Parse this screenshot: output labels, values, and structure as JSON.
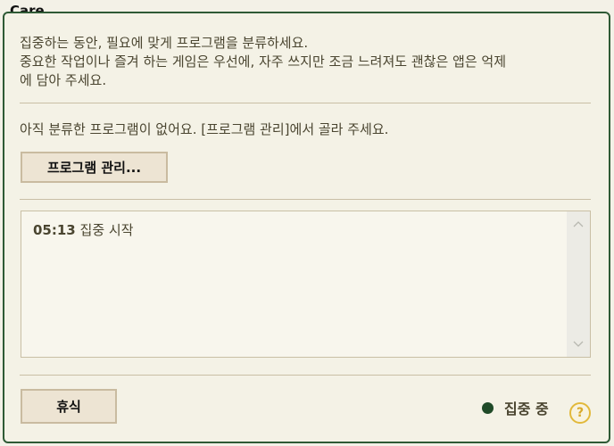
{
  "panel": {
    "title": "Care"
  },
  "intro": {
    "lines": [
      "집중하는 동안, 필요에 맞게 프로그램을 분류하세요.",
      "중요한 작업이나 즐겨 하는 게임은 우선에, 자주 쓰지만 조금 느려져도 괜찮은 앱은 억제",
      "에 담아 주세요."
    ]
  },
  "programs": {
    "empty_message": "아직 분류한 프로그램이 없어요. [프로그램 관리]에서 골라 주세요.",
    "manage_button": "프로그램 관리..."
  },
  "log": {
    "entries": [
      {
        "time": "05:13",
        "text": "집중 시작"
      }
    ]
  },
  "footer": {
    "rest_button": "휴식",
    "status_text": "집중 중",
    "help_label": "?"
  },
  "colors": {
    "accent": "#2f5a35",
    "status_dot": "#1f4a28",
    "help": "#e2b93b"
  },
  "icons": {
    "scroll_up": "chevron-up-icon",
    "scroll_down": "chevron-down-icon",
    "status": "status-dot-icon",
    "help": "help-icon"
  }
}
